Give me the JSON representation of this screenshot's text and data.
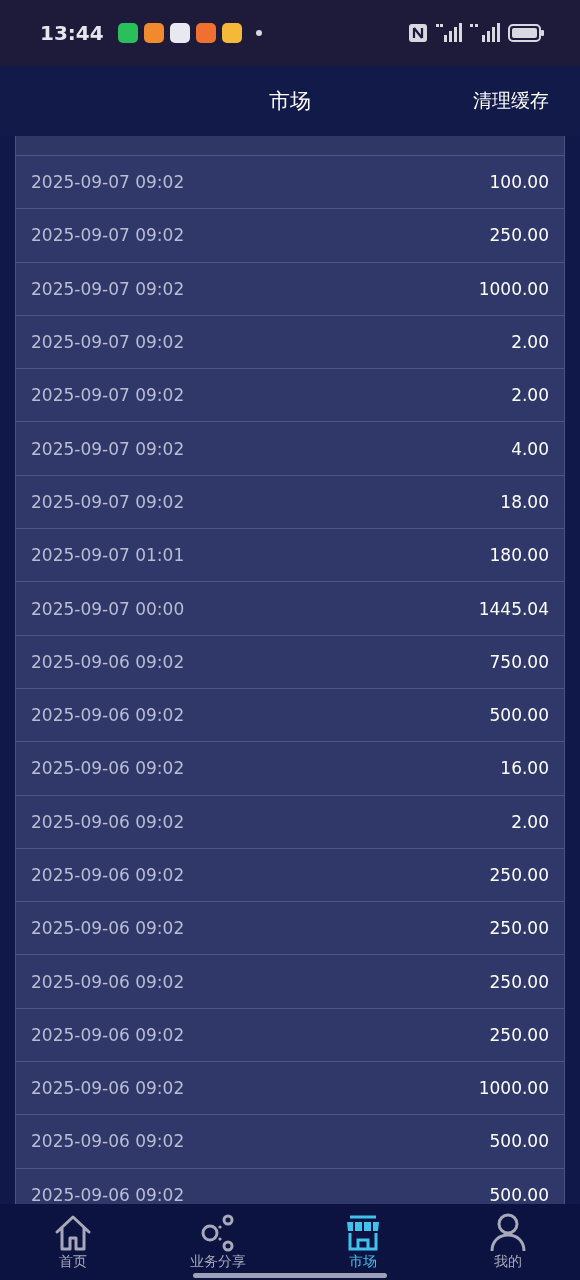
{
  "status_bar": {
    "time": "13:44"
  },
  "header": {
    "title": "市场",
    "action": "清理缓存"
  },
  "records": [
    {
      "time": "2025-09-07 09:02",
      "amount": "100.00"
    },
    {
      "time": "2025-09-07 09:02",
      "amount": "250.00"
    },
    {
      "time": "2025-09-07 09:02",
      "amount": "1000.00"
    },
    {
      "time": "2025-09-07 09:02",
      "amount": "2.00"
    },
    {
      "time": "2025-09-07 09:02",
      "amount": "2.00"
    },
    {
      "time": "2025-09-07 09:02",
      "amount": "4.00"
    },
    {
      "time": "2025-09-07 09:02",
      "amount": "18.00"
    },
    {
      "time": "2025-09-07 01:01",
      "amount": "180.00"
    },
    {
      "time": "2025-09-07 00:00",
      "amount": "1445.04"
    },
    {
      "time": "2025-09-06 09:02",
      "amount": "750.00"
    },
    {
      "time": "2025-09-06 09:02",
      "amount": "500.00"
    },
    {
      "time": "2025-09-06 09:02",
      "amount": "16.00"
    },
    {
      "time": "2025-09-06 09:02",
      "amount": "2.00"
    },
    {
      "time": "2025-09-06 09:02",
      "amount": "250.00"
    },
    {
      "time": "2025-09-06 09:02",
      "amount": "250.00"
    },
    {
      "time": "2025-09-06 09:02",
      "amount": "250.00"
    },
    {
      "time": "2025-09-06 09:02",
      "amount": "250.00"
    },
    {
      "time": "2025-09-06 09:02",
      "amount": "1000.00"
    },
    {
      "time": "2025-09-06 09:02",
      "amount": "500.00"
    },
    {
      "time": "2025-09-06 09:02",
      "amount": "500.00"
    }
  ],
  "tab_bar": [
    {
      "kind": "home",
      "label": "首页",
      "selected": false
    },
    {
      "kind": "share",
      "label": "业务分享",
      "selected": false
    },
    {
      "kind": "store",
      "label": "市场",
      "selected": true
    },
    {
      "kind": "user",
      "label": "我的",
      "selected": false
    }
  ]
}
